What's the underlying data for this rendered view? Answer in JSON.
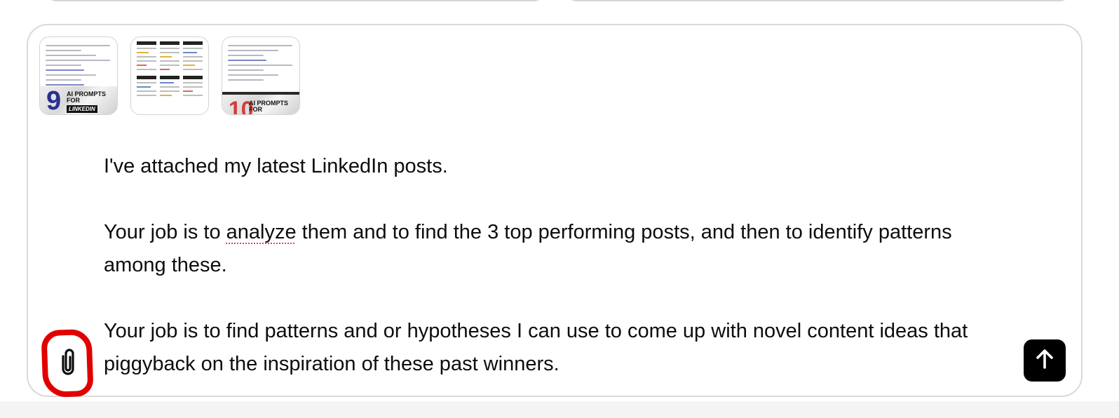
{
  "attachments": [
    {
      "kind": "post-image",
      "caption_number": "9",
      "caption_line1": "AI PROMPTS",
      "caption_line2": "FOR",
      "caption_tag": "LINKEDIN"
    },
    {
      "kind": "post-image-grid"
    },
    {
      "kind": "post-image",
      "caption_number": "10",
      "caption_line1": "AI PROMPTS",
      "caption_line2": "FOR"
    }
  ],
  "message": {
    "paragraph1": "I've attached my latest LinkedIn posts.",
    "paragraph2_before": "Your job is to ",
    "paragraph2_misspelled": "analyze",
    "paragraph2_after": " them and to find the 3 top performing posts, and then to identify patterns among these.",
    "paragraph3": "Your job is to find patterns and or hypotheses I can use to come up with novel content ideas that piggyback on the inspiration of these past winners."
  },
  "icons": {
    "attach": "paperclip-icon",
    "send": "arrow-up-icon"
  },
  "colors": {
    "annotation_circle": "#e00000",
    "send_button_bg": "#000000",
    "spellcheck_underline": "#e0445c"
  }
}
